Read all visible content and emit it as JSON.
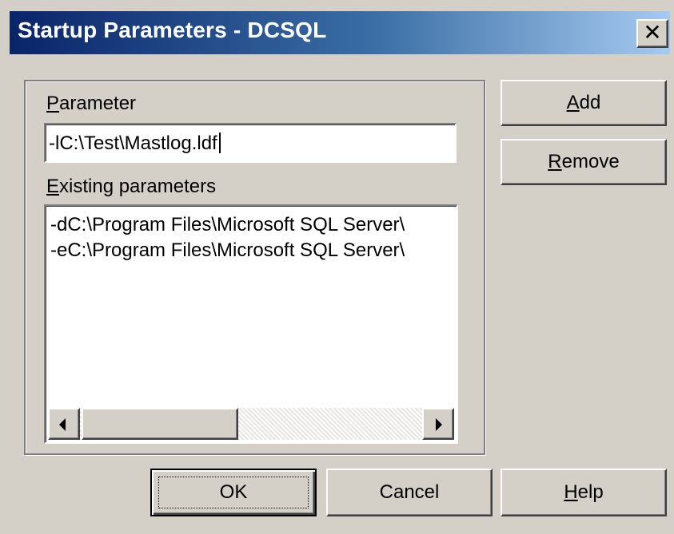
{
  "window": {
    "title": "Startup Parameters - DCSQL",
    "close_glyph": "✕"
  },
  "parameter": {
    "label_mnemonic": "P",
    "label_rest": "arameter",
    "value": "-lC:\\Test\\Mastlog.ldf"
  },
  "existing": {
    "label_mnemonic": "E",
    "label_rest": "xisting parameters",
    "items": [
      "-dC:\\Program Files\\Microsoft SQL Server\\",
      "-eC:\\Program Files\\Microsoft SQL Server\\"
    ]
  },
  "buttons": {
    "add": {
      "mnemonic": "A",
      "rest": "dd"
    },
    "remove": {
      "mnemonic": "R",
      "rest": "emove"
    },
    "ok": "OK",
    "cancel": "Cancel",
    "help": {
      "mnemonic": "H",
      "rest": "elp"
    }
  },
  "icons": {
    "close": "close-icon",
    "scroll_left": "arrow-left-icon",
    "scroll_right": "arrow-right-icon"
  },
  "colors": {
    "face": "#d4d0c8",
    "title_start": "#0a246a",
    "title_end": "#a6caf0"
  }
}
